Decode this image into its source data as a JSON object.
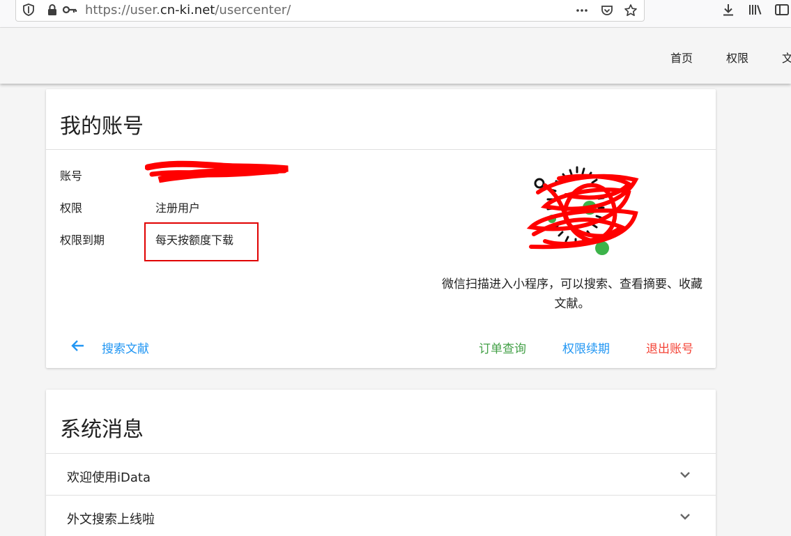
{
  "browser": {
    "url_prefix": "https://user.",
    "url_domain": "cn-ki.net",
    "url_path": "/usercenter/"
  },
  "nav": {
    "items": [
      "首页",
      "权限",
      "文"
    ]
  },
  "account": {
    "title": "我的账号",
    "rows": [
      {
        "label": "账号",
        "value": ""
      },
      {
        "label": "权限",
        "value": "注册用户"
      },
      {
        "label": "权限到期",
        "value": "每天按额度下载"
      }
    ],
    "qr_caption": "微信扫描进入小程序，可以搜索、查看摘要、收藏文献。",
    "actions": {
      "search": "搜索文献",
      "orders": "订单查询",
      "renew": "权限续期",
      "logout": "退出账号"
    },
    "colors": {
      "search": "#2196f3",
      "orders": "#43a047",
      "renew": "#2196f3",
      "logout": "#f44336",
      "highlight": "#e00000"
    }
  },
  "messages": {
    "title": "系统消息",
    "items": [
      {
        "title": "欢迎使用iData"
      },
      {
        "title": "外文搜索上线啦"
      }
    ]
  }
}
